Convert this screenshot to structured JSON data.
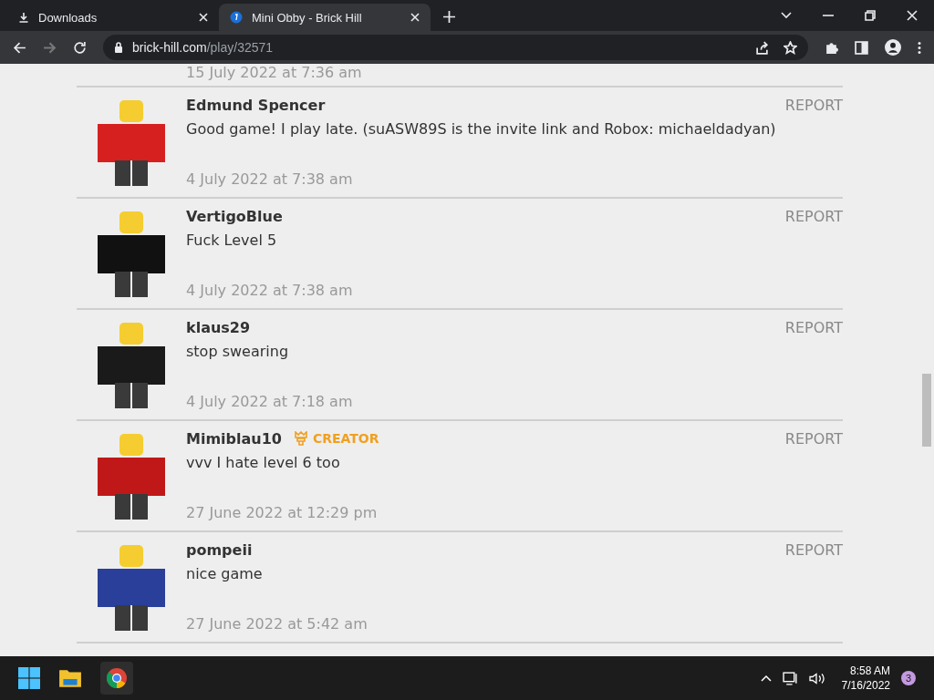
{
  "browser": {
    "tabs": [
      {
        "title": "Downloads",
        "selected": false,
        "kind": "download"
      },
      {
        "title": "Mini Obby - Brick Hill",
        "selected": true,
        "kind": "site"
      }
    ],
    "address": {
      "host": "brick-hill.com",
      "path": "/play/32571"
    }
  },
  "comments": [
    {
      "date": "15 July 2022 at 7:36 am",
      "kind": "partial"
    },
    {
      "author": "Edmund Spencer",
      "text": "Good game! I play late. (suASW89S is the invite link and Robox: michaeldadyan)",
      "date": "4 July 2022 at 7:38 am",
      "report": "REPORT"
    },
    {
      "author": "VertigoBlue",
      "text": "Fuck Level 5",
      "date": "4 July 2022 at 7:38 am",
      "report": "REPORT"
    },
    {
      "author": "klaus29",
      "text": "stop swearing",
      "date": "4 July 2022 at 7:18 am",
      "report": "REPORT"
    },
    {
      "author": "Mimiblau10",
      "badge": "CREATOR",
      "text": "vvv I hate level 6 too",
      "date": "27 June 2022 at 12:29 pm",
      "report": "REPORT"
    },
    {
      "author": "pompeii",
      "text": "nice game",
      "date": "27 June 2022 at 5:42 am",
      "report": "REPORT"
    }
  ],
  "taskbar": {
    "time": "8:58 AM",
    "date": "7/16/2022",
    "notifications": "3"
  }
}
